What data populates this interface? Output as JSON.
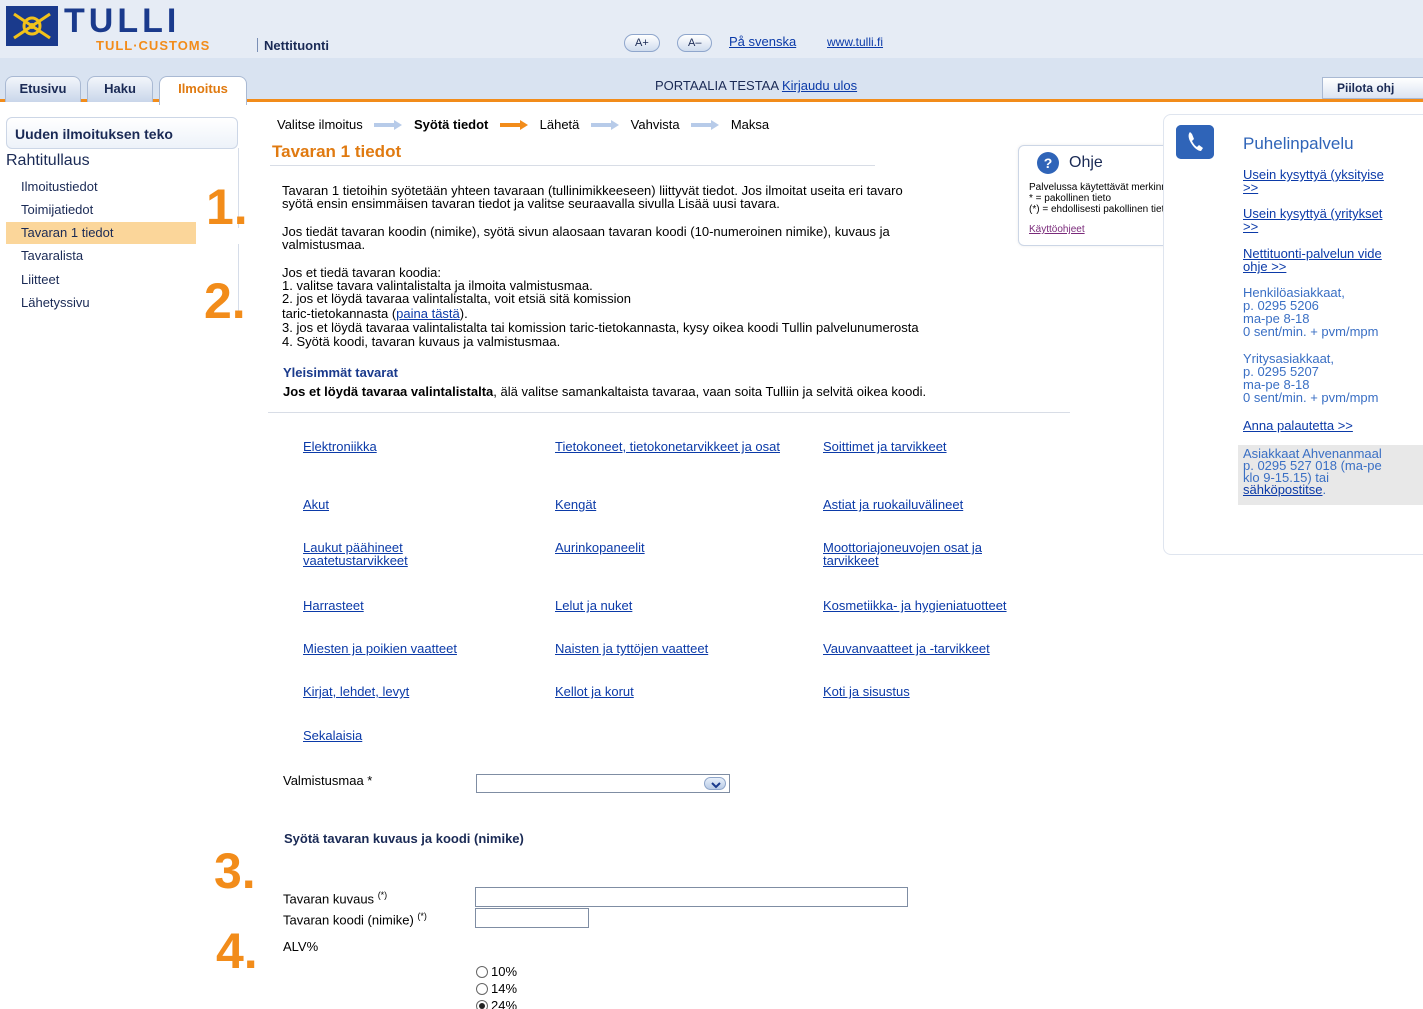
{
  "header": {
    "logo_text": "TULLI",
    "logo_sub": "TULL·CUSTOMS",
    "service": "Nettituonti",
    "font_plus": "A+",
    "font_minus": "A–",
    "lang_link": "På svenska",
    "site_link": "www.tulli.fi",
    "brand_color": "#1a3a8c",
    "accent_color": "#f28c1a"
  },
  "tabs": [
    {
      "label": "Etusivu",
      "active": false
    },
    {
      "label": "Haku",
      "active": false
    },
    {
      "label": "Ilmoitus",
      "active": true
    }
  ],
  "user": {
    "name": "PORTAALIA TESTAA",
    "logout": "Kirjaudu ulos"
  },
  "hide_help": "Piilota ohj",
  "nav": {
    "title": "Uuden ilmoituksen teko",
    "section": "Rahtitullaus",
    "items": [
      {
        "label": "Ilmoitustiedot",
        "current": false
      },
      {
        "label": "Toimijatiedot",
        "current": false
      },
      {
        "label": "Tavaran 1 tiedot",
        "current": true
      },
      {
        "label": "Tavaralista",
        "current": false
      },
      {
        "label": "Liitteet",
        "current": false
      },
      {
        "label": "Lähetyssivu",
        "current": false
      }
    ]
  },
  "step_markers": [
    "1.",
    "2.",
    "3.",
    "4."
  ],
  "breadcrumb": {
    "steps": [
      "Valitse ilmoitus",
      "Syötä tiedot",
      "Lähetä",
      "Vahvista",
      "Maksa"
    ],
    "current_index": 1
  },
  "main": {
    "title": "Tavaran 1 tiedot",
    "intro_line1": "Tavaran 1 tietoihin syötetään yhteen tavaraan (tullinimikkeeseen) liittyvät tiedot. Jos ilmoitat useita eri tavaro",
    "intro_line2": "syötä ensin ensimmäisen tavaran tiedot ja valitse seuraavalla sivulla Lisää uusi tavara.",
    "known_line1": "Jos tiedät tavaran koodin (nimike), syötä sivun alaosaan tavaran koodi (10-numeroinen nimike), kuvaus ja",
    "known_line2": "valmistusmaa.",
    "unknown_title": "Jos et tiedä tavaran koodia:",
    "unknown_1": "1. valitse tavara valintalistalta ja ilmoita valmistusmaa.",
    "unknown_2a": "2. jos et löydä tavaraa valintalistalta, voit etsiä sitä komission",
    "unknown_2b_pre": "taric-tietokannasta (",
    "unknown_2b_link": "paina tästä",
    "unknown_2b_post": ").",
    "unknown_3": "3. jos et löydä tavaraa valintalistalta tai komission taric-tietokannasta, kysy oikea koodi Tullin palvelunumerosta",
    "unknown_4": "4. Syötä koodi, tavaran kuvaus ja valmistusmaa.",
    "common_title": "Yleisimmät tavarat",
    "note_bold": "Jos et löydä tavaraa valintalistalta",
    "note_rest": ", älä valitse samankaltaista tavaraa, vaan soita Tulliin ja selvitä oikea koodi."
  },
  "categories": [
    [
      "Elektroniikka",
      "Tietokoneet, tietokonetarvikkeet ja osat",
      "Soittimet ja tarvikkeet"
    ],
    [
      "Akut",
      "Kengät",
      "Astiat ja ruokailuvälineet"
    ],
    [
      "Laukut päähineet vaatetustarvikkeet",
      "Aurinkopaneelit",
      "Moottoriajoneuvojen osat ja tarvikkeet"
    ],
    [
      "Harrasteet",
      "Lelut ja nuket",
      "Kosmetiikka- ja hygieniatuotteet"
    ],
    [
      "Miesten ja poikien vaatteet",
      "Naisten ja tyttöjen vaatteet",
      "Vauvanvaatteet ja -tarvikkeet"
    ],
    [
      "Kirjat, lehdet, levyt",
      "Kellot ja korut",
      "Koti ja sisustus"
    ],
    [
      "Sekalaisia"
    ]
  ],
  "form": {
    "country_label": "Valmistusmaa *",
    "country_value": "",
    "desc_title": "Syötä tavaran kuvaus ja koodi (nimike)",
    "desc_label": "Tavaran kuvaus",
    "desc_mark": "(*)",
    "desc_value": "",
    "code_label": "Tavaran koodi (nimike)",
    "code_mark": "(*)",
    "code_value": "",
    "vat_label": "ALV%",
    "vat_options": [
      {
        "label": "10%",
        "selected": false
      },
      {
        "label": "14%",
        "selected": false
      },
      {
        "label": "24%",
        "selected": true
      }
    ]
  },
  "help": {
    "title": "Ohje",
    "body_1": "Palvelussa käytettävät merkinnät:",
    "body_2": "* = pakollinen tieto",
    "body_3": "(*) = ehdollisesti pakollinen tieto",
    "link": "Käyttöohjeet"
  },
  "phone": {
    "title": "Puhelinpalvelu",
    "link1_a": "Usein kysyttyä (yksityise",
    "link1_b": ">>",
    "link2_a": "Usein kysyttyä (yritykset",
    "link2_b": ">>",
    "link3_a": "Nettituonti-palvelun vide",
    "link3_b": "ohje >>",
    "private_1": "Henkilöasiakkaat,",
    "private_2": "p. 0295 5206",
    "private_3": "ma-pe 8-18",
    "private_4": "0 sent/min. + pvm/mpm",
    "business_1": "Yritysasiakkaat,",
    "business_2": "p. 0295 5207",
    "business_3": "ma-pe 8-18",
    "business_4": "0 sent/min. + pvm/mpm",
    "feedback": "Anna palautetta >>",
    "aland_1": "Asiakkaat Ahvenanmaal",
    "aland_2": "p. 0295 527 018 (ma-pe",
    "aland_3": "klo 9-15.15) tai",
    "aland_link": "sähköpostitse",
    "aland_end": "."
  }
}
